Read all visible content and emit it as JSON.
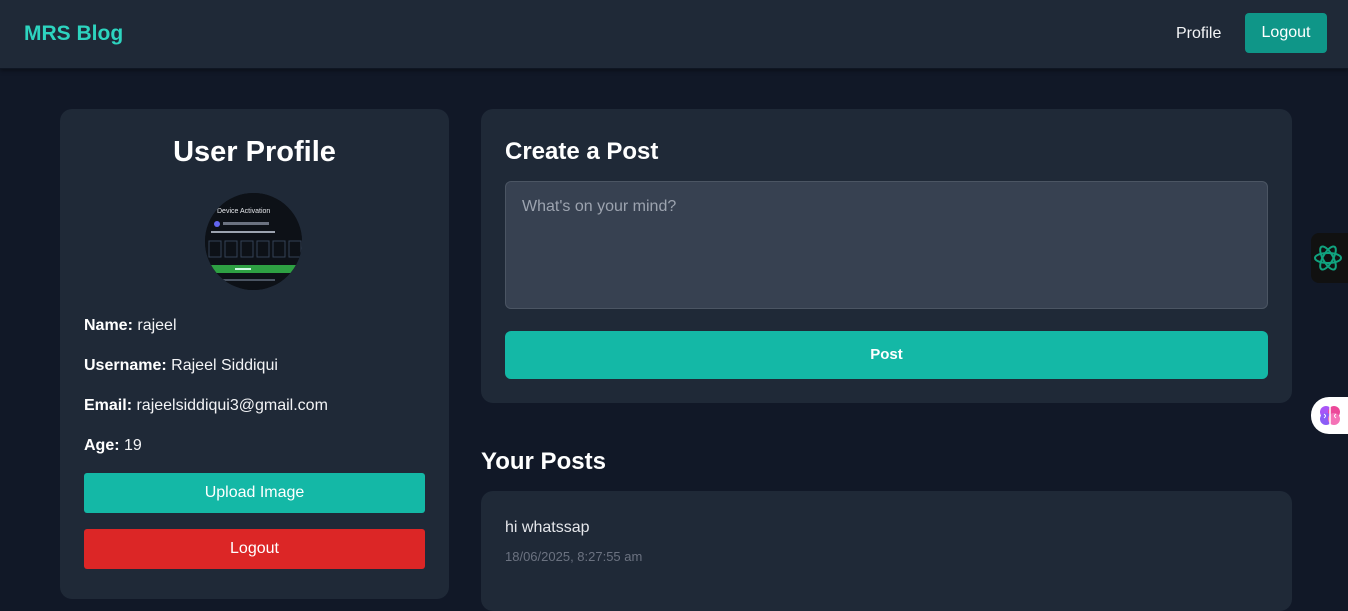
{
  "navbar": {
    "brand": "MRS Blog",
    "profile_link": "Profile",
    "logout_label": "Logout"
  },
  "profile": {
    "title": "User Profile",
    "avatar_caption": "Device Activation",
    "name_label": "Name:",
    "name_value": "rajeel",
    "username_label": "Username:",
    "username_value": "Rajeel Siddiqui",
    "email_label": "Email:",
    "email_value": "rajeelsiddiqui3@gmail.com",
    "age_label": "Age:",
    "age_value": "19",
    "upload_label": "Upload Image",
    "logout_label": "Logout"
  },
  "create_post": {
    "title": "Create a Post",
    "placeholder": "What's on your mind?",
    "button_label": "Post"
  },
  "posts": {
    "heading": "Your Posts",
    "items": [
      {
        "content": "hi whatssap",
        "timestamp": "18/06/2025, 8:27:55 am"
      }
    ]
  },
  "colors": {
    "accent": "#14b8a6",
    "brand": "#2dd4bf",
    "danger": "#dc2626",
    "background": "#111827",
    "card": "#1f2937"
  },
  "icons": {
    "floating_ai": "openai-logo-icon",
    "floating_brain": "brain-icon"
  }
}
